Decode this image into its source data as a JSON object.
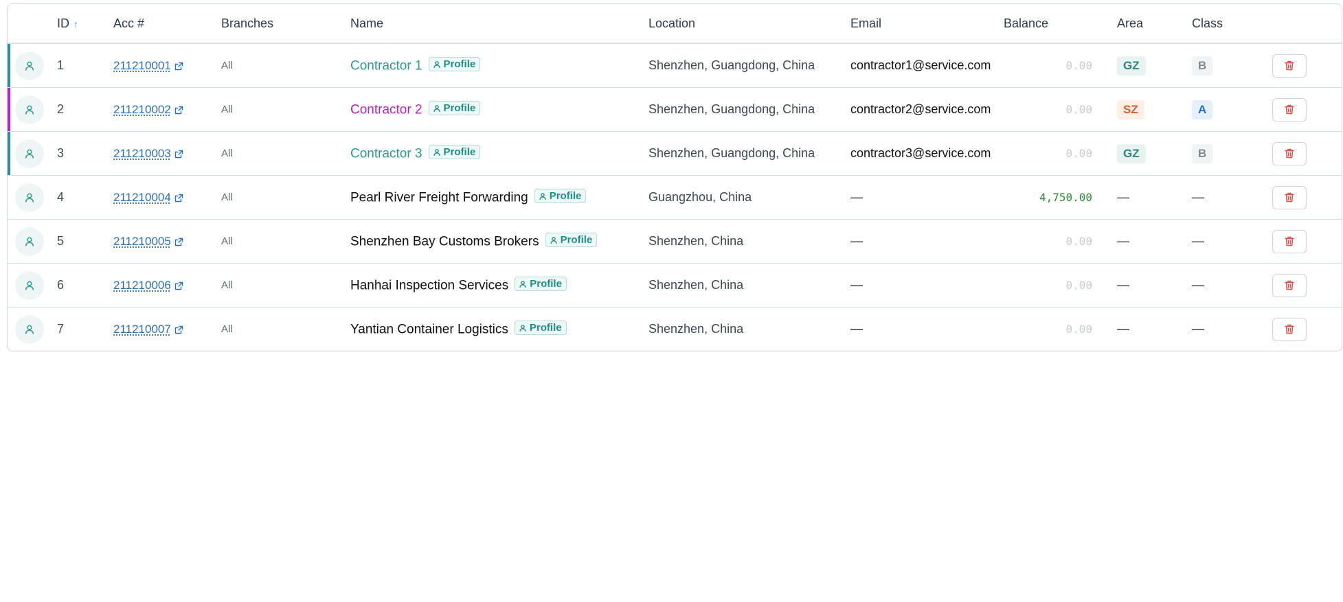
{
  "columns": {
    "id": "ID",
    "id_sort": "↑",
    "acc": "Acc #",
    "branches": "Branches",
    "name": "Name",
    "location": "Location",
    "email": "Email",
    "balance": "Balance",
    "area": "Area",
    "class": "Class"
  },
  "colors": {
    "teal": "#2b9a94",
    "magenta": "#c01ec9",
    "delete": "#e04848"
  },
  "icons": {
    "avatar": "user-icon",
    "external": "external-link-icon",
    "profile": "user-icon",
    "delete": "trash-icon"
  },
  "rows": [
    {
      "id": "1",
      "acc": "211210001",
      "branches": "All",
      "name": "Contractor 1",
      "profile": "Profile",
      "location": "Shenzhen, Guangdong, China",
      "email": "contractor1@service.com",
      "balance": "0.00",
      "area": "GZ",
      "class": "B",
      "accent": "#2b8f9a"
    },
    {
      "id": "2",
      "acc": "211210002",
      "branches": "All",
      "name": "Contractor 2",
      "profile": "Profile",
      "location": "Shenzhen, Guangdong, China",
      "email": "contractor2@service.com",
      "balance": "0.00",
      "area": "SZ",
      "class": "A",
      "accent": "#c01ec9"
    },
    {
      "id": "3",
      "acc": "211210003",
      "branches": "All",
      "name": "Contractor 3",
      "profile": "Profile",
      "location": "Shenzhen, Guangdong, China",
      "email": "contractor3@service.com",
      "balance": "0.00",
      "area": "GZ",
      "class": "B",
      "accent": "#2b8f9a"
    },
    {
      "id": "4",
      "acc": "211210004",
      "branches": "All",
      "name": "Pearl River Freight Forwarding",
      "profile": "Profile",
      "location": "Guangzhou, China",
      "email": "—",
      "balance": "4,750.00",
      "area": "—",
      "class": "—"
    },
    {
      "id": "5",
      "acc": "211210005",
      "branches": "All",
      "name": "Shenzhen Bay Customs Brokers",
      "profile": "Profile",
      "location": "Shenzhen, China",
      "email": "—",
      "balance": "0.00",
      "area": "—",
      "class": "—"
    },
    {
      "id": "6",
      "acc": "211210006",
      "branches": "All",
      "name": "Hanhai Inspection Services",
      "profile": "Profile",
      "location": "Shenzhen, China",
      "email": "—",
      "balance": "0.00",
      "area": "—",
      "class": "—"
    },
    {
      "id": "7",
      "acc": "211210007",
      "branches": "All",
      "name": "Yantian Container Logistics",
      "profile": "Profile",
      "location": "Shenzhen, China",
      "email": "—",
      "balance": "0.00",
      "area": "—",
      "class": "—"
    }
  ]
}
